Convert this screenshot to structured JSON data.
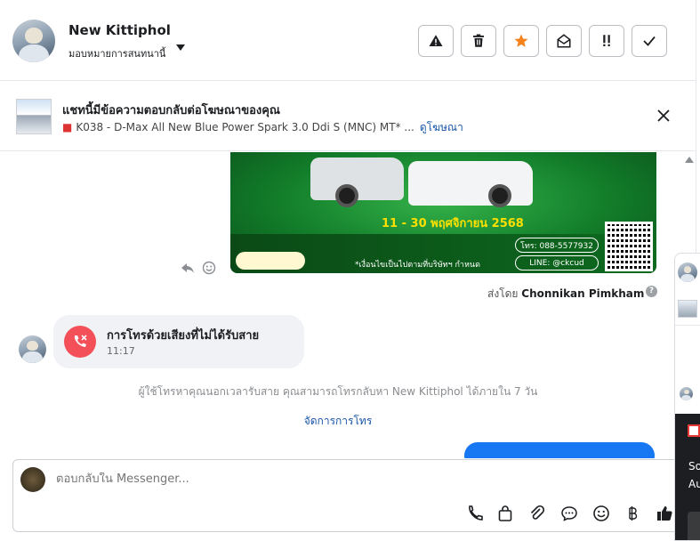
{
  "header": {
    "name": "New Kittiphol",
    "subtitle": "มอบหมายการสนทนานี้"
  },
  "toolbar": {
    "buttons": [
      "warning-icon",
      "trash-icon",
      "star-icon",
      "envelope-open-icon",
      "exclamations-icon",
      "check-icon"
    ],
    "accent": "#f5841f"
  },
  "ad": {
    "title": "แชทนี้มีข้อความตอบกลับต่อโฆษณาของคุณ",
    "product": "K038 - D-Max All New Blue Power Spark 3.0 Ddi S (MNC) MT* ...",
    "link": "ดูโฆษณา"
  },
  "poster": {
    "date_range": "11 - 30 พฤศจิกายน 2568",
    "phone": "โทร: 088-5577932",
    "line": "LINE: @ckcud",
    "note": "*เงื่อนไขเป็นไปตามที่บริษัทฯ กำหนด"
  },
  "thread": {
    "sent_by_prefix": "ส่งโดย",
    "sent_by_name": "Chonnikan Pimkham",
    "missed_call_title": "การโทรด้วยเสียงที่ไม่ได้รับสาย",
    "missed_call_time": "11:17",
    "system_message": "ผู้ใช้โทรหาคุณนอกเวลารับสาย คุณสามารถโทรกลับหา New Kittiphol ได้ภายใน 7 วัน",
    "manage_calls": "จัดการการโทร"
  },
  "composer": {
    "placeholder": "ตอบกลับใน Messenger..."
  },
  "side_panel": {
    "text_line1": "So",
    "text_line2": "Au"
  },
  "colors": {
    "missed_call": "#f4505a",
    "link": "#1a56a8",
    "messenger_blue": "#1877f2"
  }
}
